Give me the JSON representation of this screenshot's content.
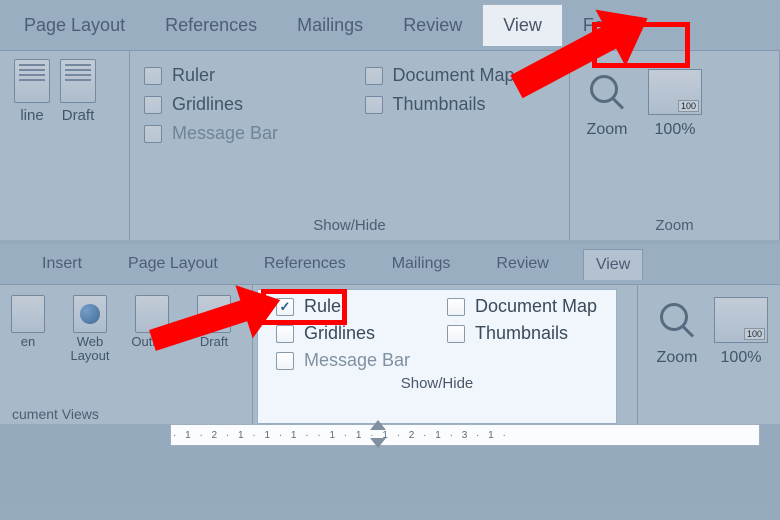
{
  "top": {
    "tabs": [
      "Page Layout",
      "References",
      "Mailings",
      "Review",
      "View",
      "Foxit"
    ],
    "active_tab": "View",
    "views": {
      "line": "line",
      "draft": "Draft"
    },
    "showhide": {
      "ruler": "Ruler",
      "gridlines": "Gridlines",
      "message_bar": "Message Bar",
      "doc_map": "Document Map",
      "thumbnails": "Thumbnails",
      "group_label": "Show/Hide"
    },
    "zoom": {
      "zoom": "Zoom",
      "hundred": "100%",
      "group_label": "Zoom"
    }
  },
  "bottom": {
    "tabs": [
      "Insert",
      "Page Layout",
      "References",
      "Mailings",
      "Review",
      "View"
    ],
    "active_tab": "View",
    "views": {
      "en": "en",
      "web": "Web Layout",
      "outline": "Outline",
      "draft": "Draft",
      "group_label": "cument Views"
    },
    "showhide": {
      "ruler": "Ruler",
      "ruler_checked": true,
      "gridlines": "Gridlines",
      "message_bar": "Message Bar",
      "doc_map": "Document Map",
      "thumbnails": "Thumbnails",
      "group_label": "Show/Hide"
    },
    "zoom": {
      "zoom": "Zoom",
      "hundred": "100%"
    }
  },
  "ruler_text": "· 1 · 2 · 1 · 1 · 1 ·   · 1 · 1 · 1 · 2 · 1 · 3 · 1 ·"
}
